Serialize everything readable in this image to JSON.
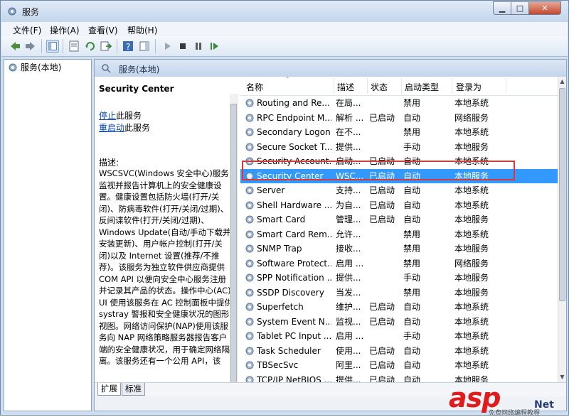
{
  "window": {
    "title": "服务"
  },
  "menubar": [
    "文件(F)",
    "操作(A)",
    "查看(V)",
    "帮助(H)"
  ],
  "tree": {
    "label": "服务(本地)"
  },
  "panel": {
    "header": "服务(本地)"
  },
  "details": {
    "service_name": "Security Center",
    "stop_link": "停止",
    "stop_suffix": "此服务",
    "restart_link": "重启动",
    "restart_suffix": "此服务",
    "desc_label": "描述:",
    "desc_text": "WSCSVC(Windows 安全中心)服务监视并报告计算机上的安全健康设置。健康设置包括防火墙(打开/关闭)、防病毒软件(打开/关闭/过期)、反间谍软件(打开/关闭/过期)、Windows Update(自动/手动下载并安装更新)、用户帐户控制(打开/关闭)以及 Internet 设置(推荐/不推荐)。该服务为独立软件供应商提供 COM API 以便向安全中心服务注册并记录其产品的状态。操作中心(AC) UI 使用该服务在 AC 控制面板中提供 systray 警报和安全健康状况的图形视图。网络访问保护(NAP)使用该服务向 NAP 网络策略服务器报告客户端的安全健康状况，用于确定网络隔离。该服务还有一个公用 API，该"
  },
  "columns": [
    "名称",
    "描述",
    "状态",
    "启动类型",
    "登录为"
  ],
  "rows": [
    {
      "name": "Routing and Re...",
      "desc": "在局...",
      "status": "",
      "startup": "禁用",
      "logon": "本地系统"
    },
    {
      "name": "RPC Endpoint M...",
      "desc": "解析 ...",
      "status": "已启动",
      "startup": "自动",
      "logon": "网络服务"
    },
    {
      "name": "Secondary Logon",
      "desc": "在不...",
      "status": "",
      "startup": "禁用",
      "logon": "本地系统"
    },
    {
      "name": "Secure Socket T...",
      "desc": "提供...",
      "status": "",
      "startup": "手动",
      "logon": "本地服务"
    },
    {
      "name": "Security Account...",
      "desc": "启动...",
      "status": "已启动",
      "startup": "自动",
      "logon": "本地系统"
    },
    {
      "name": "Security Center",
      "desc": "WSC...",
      "status": "已启动",
      "startup": "自动",
      "logon": "本地服务",
      "selected": true
    },
    {
      "name": "Server",
      "desc": "支持...",
      "status": "已启动",
      "startup": "自动",
      "logon": "本地系统"
    },
    {
      "name": "Shell Hardware ...",
      "desc": "为自...",
      "status": "已启动",
      "startup": "自动",
      "logon": "本地系统"
    },
    {
      "name": "Smart Card",
      "desc": "管理...",
      "status": "已启动",
      "startup": "自动",
      "logon": "本地服务"
    },
    {
      "name": "Smart Card Rem...",
      "desc": "允许...",
      "status": "",
      "startup": "禁用",
      "logon": "本地系统"
    },
    {
      "name": "SNMP Trap",
      "desc": "接收...",
      "status": "",
      "startup": "禁用",
      "logon": "本地服务"
    },
    {
      "name": "Software Protect...",
      "desc": "启用 ...",
      "status": "",
      "startup": "禁用",
      "logon": "网络服务"
    },
    {
      "name": "SPP Notification ...",
      "desc": "提供...",
      "status": "",
      "startup": "手动",
      "logon": "本地服务"
    },
    {
      "name": "SSDP Discovery",
      "desc": "当发...",
      "status": "",
      "startup": "禁用",
      "logon": "本地服务"
    },
    {
      "name": "Superfetch",
      "desc": "维护...",
      "status": "已启动",
      "startup": "自动",
      "logon": "本地系统"
    },
    {
      "name": "System Event N...",
      "desc": "监视...",
      "status": "已启动",
      "startup": "自动",
      "logon": "本地系统"
    },
    {
      "name": "Tablet PC Input ...",
      "desc": "启用 ...",
      "status": "",
      "startup": "手动",
      "logon": "本地系统"
    },
    {
      "name": "Task Scheduler",
      "desc": "使用...",
      "status": "已启动",
      "startup": "自动",
      "logon": "本地系统"
    },
    {
      "name": "TBSecSvc",
      "desc": "阿里...",
      "status": "已启动",
      "startup": "自动",
      "logon": "本地系统"
    },
    {
      "name": "TCP/IP NetBIOS ...",
      "desc": "提供...",
      "status": "已启动",
      "startup": "自动",
      "logon": "本地服务"
    }
  ],
  "tabs": [
    "扩展",
    "标准"
  ],
  "watermark": {
    "logo": "asp",
    "sub": "免费网络编程教程",
    "net": "Net"
  },
  "colors": {
    "selection": "#3399ff",
    "highlight_box": "#d63b3b"
  }
}
